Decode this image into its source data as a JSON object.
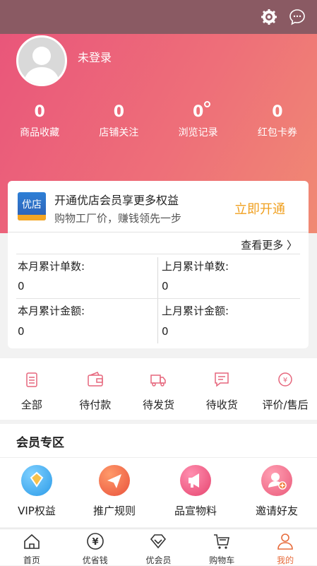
{
  "header": {
    "settings_icon": "gear-icon",
    "message_icon": "chat-icon"
  },
  "profile": {
    "login_text": "未登录"
  },
  "stats": [
    {
      "value": "0",
      "label": "商品收藏"
    },
    {
      "value": "0",
      "label": "店铺关注"
    },
    {
      "value": "0",
      "label": "浏览记录"
    },
    {
      "value": "0",
      "label": "红包卡券"
    }
  ],
  "vip_card": {
    "logo_text": "优店",
    "title": "开通优店会员享更多权益",
    "subtitle": "购物工厂价，赚钱领先一步",
    "open_label": "立即开通",
    "more_label": "查看更多",
    "cells": [
      {
        "label": "本月累计单数:",
        "value": "0"
      },
      {
        "label": "上月累计单数:",
        "value": "0"
      },
      {
        "label": "本月累计金额:",
        "value": "0"
      },
      {
        "label": "上月累计金额:",
        "value": "0"
      }
    ]
  },
  "orders": [
    {
      "label": "全部",
      "icon": "clipboard-icon"
    },
    {
      "label": "待付款",
      "icon": "wallet-icon"
    },
    {
      "label": "待发货",
      "icon": "truck-icon"
    },
    {
      "label": "待收货",
      "icon": "message-box-icon"
    },
    {
      "label": "评价/售后",
      "icon": "yen-refund-icon"
    }
  ],
  "member_zone": {
    "title": "会员专区",
    "items": [
      {
        "label": "VIP权益",
        "icon": "vip-diamond-icon",
        "color": "#f0a020"
      },
      {
        "label": "推广规则",
        "icon": "paper-plane-icon",
        "color": "#f07a3a"
      },
      {
        "label": "品宣物料",
        "icon": "megaphone-icon",
        "color": "#ee5f7a"
      },
      {
        "label": "邀请好友",
        "icon": "add-user-icon",
        "color": "#ee5f7a"
      }
    ]
  },
  "tabbar": [
    {
      "label": "首页",
      "icon": "home-icon"
    },
    {
      "label": "优省钱",
      "icon": "yen-coin-icon"
    },
    {
      "label": "优会员",
      "icon": "diamond-icon"
    },
    {
      "label": "购物车",
      "icon": "cart-icon"
    },
    {
      "label": "我的",
      "icon": "person-icon",
      "active": true
    }
  ]
}
